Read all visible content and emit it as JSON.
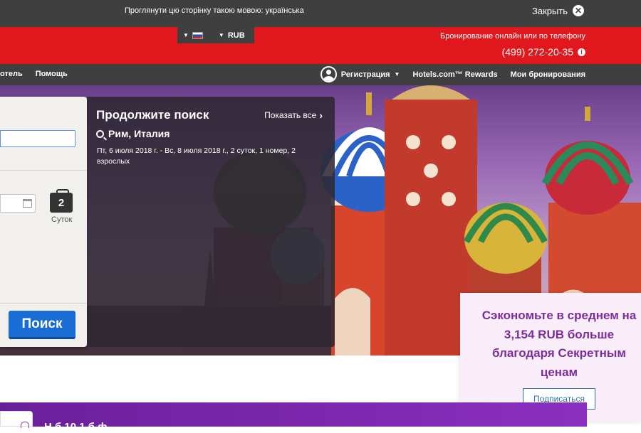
{
  "language_banner": {
    "text": "Проглянути цю сторінку такою мовою: українська",
    "close_label": "Закрыть",
    "close_icon": "close-icon"
  },
  "header": {
    "locale_flag": "russia-flag-icon",
    "currency": "RUB",
    "booking_text": "Бронирование онлайн или по телефону",
    "phone": "(499) 272-20-35",
    "info_icon": "i"
  },
  "nav": {
    "left_items": [
      "отель",
      "Помощь"
    ],
    "register": "Регистрация",
    "rewards": "Hotels.com™ Rewards",
    "bookings": "Мои бронирования"
  },
  "search_form": {
    "destination_value": "",
    "checkin_value": "",
    "nights": "2",
    "nights_label": "Суток",
    "search_button": "Поиск"
  },
  "continue_search": {
    "title": "Продолжите поиск",
    "show_all": "Показать все",
    "city": "Рим, Италия",
    "details": "Пт, 6 июля 2018 г. - Вс, 8 июля 2018 г., 2 суток, 1 номер, 2 взрослых"
  },
  "promo": {
    "text": "Сэкономьте в среднем на\n3,154 RUB больше\nблагодаря Секретным\nценам",
    "button": "Подписаться",
    "accent_color": "#7b2e9a"
  },
  "bottom_banner": {
    "text": "Н б     10                      1         б       ф"
  },
  "colors": {
    "brand_red": "#e0181d",
    "dark_bar": "#3f3f3f",
    "search_blue": "#1a6dd4"
  }
}
